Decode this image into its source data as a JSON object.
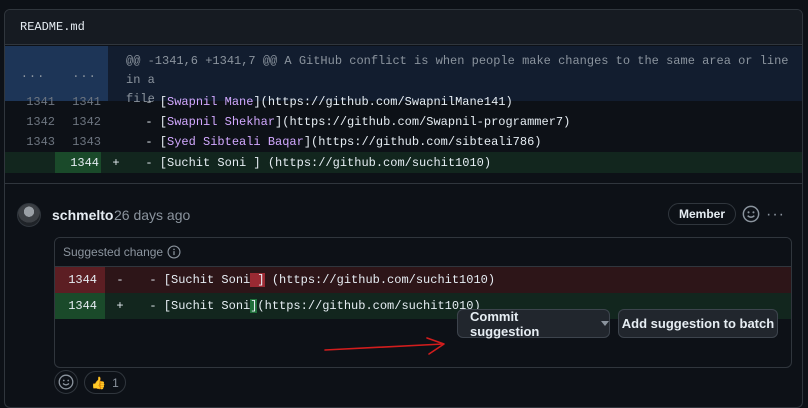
{
  "file": {
    "name": "README.md"
  },
  "hunk": {
    "left_ellipsis": "...",
    "right_ellipsis": "...",
    "header": "@@ -1341,6 +1341,7 @@ A GitHub conflict is when people make changes to the same area or line in a",
    "header_wrap": "file"
  },
  "diff_lines": [
    {
      "old": "1341",
      "new": "1341",
      "sign": "",
      "prefix": "  - [",
      "name": "Swapnil Mane",
      "suffix": "](https://github.com/SwapnilMane141)"
    },
    {
      "old": "1342",
      "new": "1342",
      "sign": "",
      "prefix": "  - [",
      "name": "Swapnil Shekhar",
      "suffix": "](https://github.com/Swapnil-programmer7)"
    },
    {
      "old": "1343",
      "new": "1343",
      "sign": "",
      "prefix": "  - [",
      "name": "Syed Sibteali Baqar",
      "suffix": "](https://github.com/sibteali786)"
    },
    {
      "old": "",
      "new": "1344",
      "sign": "+",
      "text": "  - [Suchit Soni ] (https://github.com/suchit1010)"
    }
  ],
  "comment": {
    "author": "schmelto",
    "time": "26 days ago",
    "badge": "Member",
    "more": "···"
  },
  "suggestion": {
    "title": "Suggested change",
    "removed": {
      "num": "1344",
      "sign": "-",
      "pre": "  - [Suchit Soni",
      "hl": " ]",
      "post": " (https://github.com/suchit1010)"
    },
    "added": {
      "num": "1344",
      "sign": "+",
      "pre": "  - [Suchit Soni",
      "hl": "]",
      "post": "(https://github.com/suchit1010)"
    }
  },
  "buttons": {
    "commit": "Commit suggestion",
    "batch": "Add suggestion to batch"
  },
  "reactions": {
    "thumbs_emoji": "👍",
    "thumbs_count": "1"
  },
  "colors": {
    "background": "#0d1117",
    "added_line": "#12261e",
    "removed_line": "#2d1518",
    "annotation_arrow": "#d21d1d"
  }
}
